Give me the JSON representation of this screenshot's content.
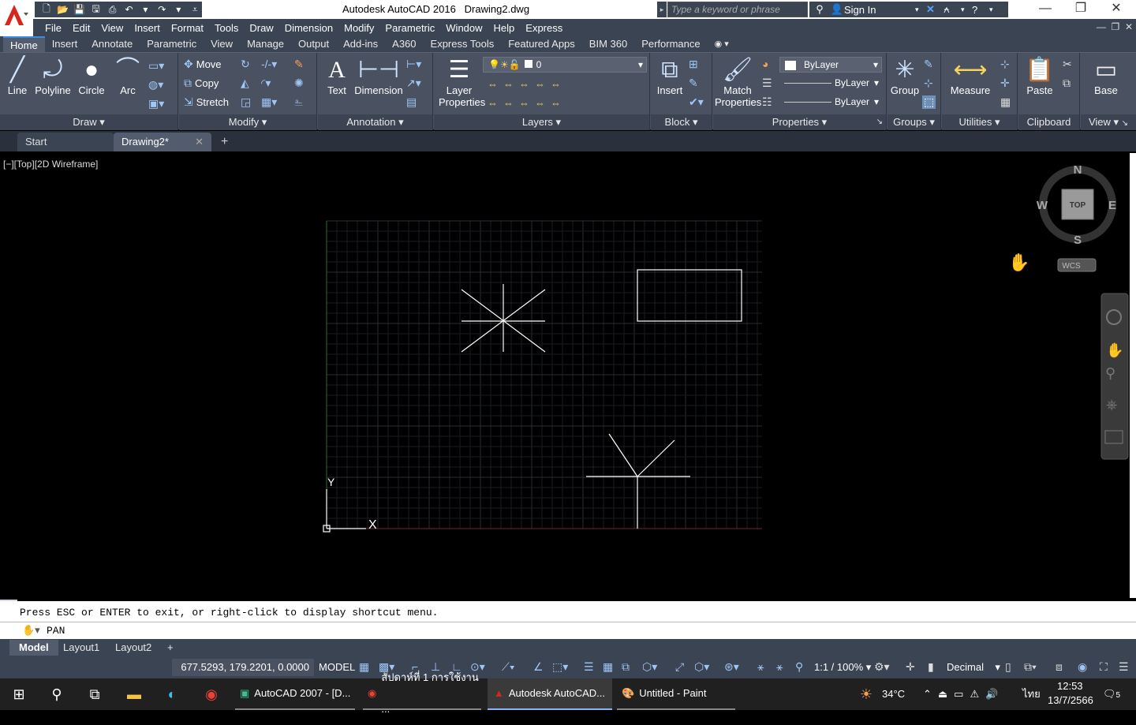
{
  "window": {
    "title": "Autodesk AutoCAD 2016",
    "document": "Drawing2.dwg",
    "search_placeholder": "Type a keyword or phrase",
    "sign_in": "Sign In"
  },
  "menu": [
    "File",
    "Edit",
    "View",
    "Insert",
    "Format",
    "Tools",
    "Draw",
    "Dimension",
    "Modify",
    "Parametric",
    "Window",
    "Help",
    "Express"
  ],
  "ribbon_tabs": [
    "Home",
    "Insert",
    "Annotate",
    "Parametric",
    "View",
    "Manage",
    "Output",
    "Add-ins",
    "A360",
    "Express Tools",
    "Featured Apps",
    "BIM 360",
    "Performance"
  ],
  "ribbon": {
    "draw": {
      "title": "Draw",
      "line": "Line",
      "polyline": "Polyline",
      "circle": "Circle",
      "arc": "Arc"
    },
    "modify": {
      "title": "Modify",
      "move": "Move",
      "copy": "Copy",
      "stretch": "Stretch"
    },
    "annotation": {
      "title": "Annotation",
      "text": "Text",
      "dimension": "Dimension"
    },
    "layers": {
      "title": "Layers",
      "layer_properties_1": "Layer",
      "layer_properties_2": "Properties",
      "current_layer": "0"
    },
    "block": {
      "title": "Block",
      "insert": "Insert"
    },
    "properties": {
      "title": "Properties",
      "match_1": "Match",
      "match_2": "Properties",
      "color": "ByLayer",
      "linetype": "ByLayer",
      "lineweight": "ByLayer"
    },
    "groups": {
      "title": "Groups",
      "group": "Group"
    },
    "utilities": {
      "title": "Utilities",
      "measure": "Measure"
    },
    "clipboard": {
      "title": "Clipboard",
      "paste": "Paste"
    },
    "view": {
      "title": "View",
      "base": "Base"
    }
  },
  "file_tabs": {
    "start": "Start",
    "drawing": "Drawing2*"
  },
  "viewport_label": "[−][Top][2D Wireframe]",
  "viewcube": {
    "n": "N",
    "s": "S",
    "e": "E",
    "w": "W",
    "top": "TOP",
    "wcs": "WCS"
  },
  "ucs": {
    "x": "X",
    "y": "Y"
  },
  "command": {
    "history": "Press ESC or ENTER to exit, or right-click to display shortcut menu.",
    "current": "PAN"
  },
  "layout_tabs": [
    "Model",
    "Layout1",
    "Layout2"
  ],
  "status": {
    "coords": "677.5293, 179.2201, 0.0000",
    "model": "MODEL",
    "scale": "1:1 / 100%",
    "units": "Decimal"
  },
  "taskbar": {
    "apps": [
      "AutoCAD 2007 - [D...",
      "สัปดาห์ที่ 1 การใช้งาน ...",
      "Autodesk AutoCAD...",
      "Untitled - Paint"
    ],
    "weather": "34°C",
    "lang": "ไทย",
    "time": "12:53",
    "date": "13/7/2566",
    "notifications": "5"
  }
}
